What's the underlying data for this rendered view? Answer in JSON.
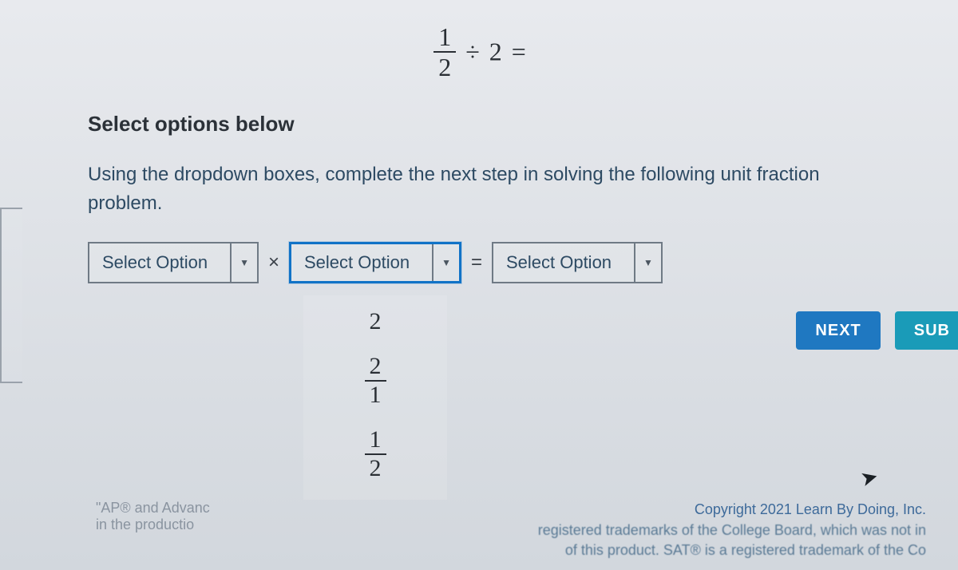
{
  "equation": {
    "frac_num": "1",
    "frac_den": "2",
    "rest": "÷ 2 ="
  },
  "section_title": "Select options below",
  "instruction": "Using the dropdown boxes, complete the next step in solving the following unit fraction problem.",
  "expression": {
    "d1_placeholder": "Select Option",
    "op1": "×",
    "d2_placeholder": "Select Option",
    "op2": "=",
    "d3_placeholder": "Select Option"
  },
  "options": {
    "o1": "2",
    "o2_num": "2",
    "o2_den": "1",
    "o3_num": "1",
    "o3_den": "2"
  },
  "buttons": {
    "next": "NEXT",
    "submit": "SUB"
  },
  "footer": {
    "left_line1": "\"AP® and Advanc",
    "left_line2": "in the productio",
    "copyright": "Copyright 2021 Learn By Doing, Inc.",
    "blurb1": "registered trademarks of the College Board, which was not in",
    "blurb2": "of this product. SAT® is a registered trademark of the Co"
  }
}
